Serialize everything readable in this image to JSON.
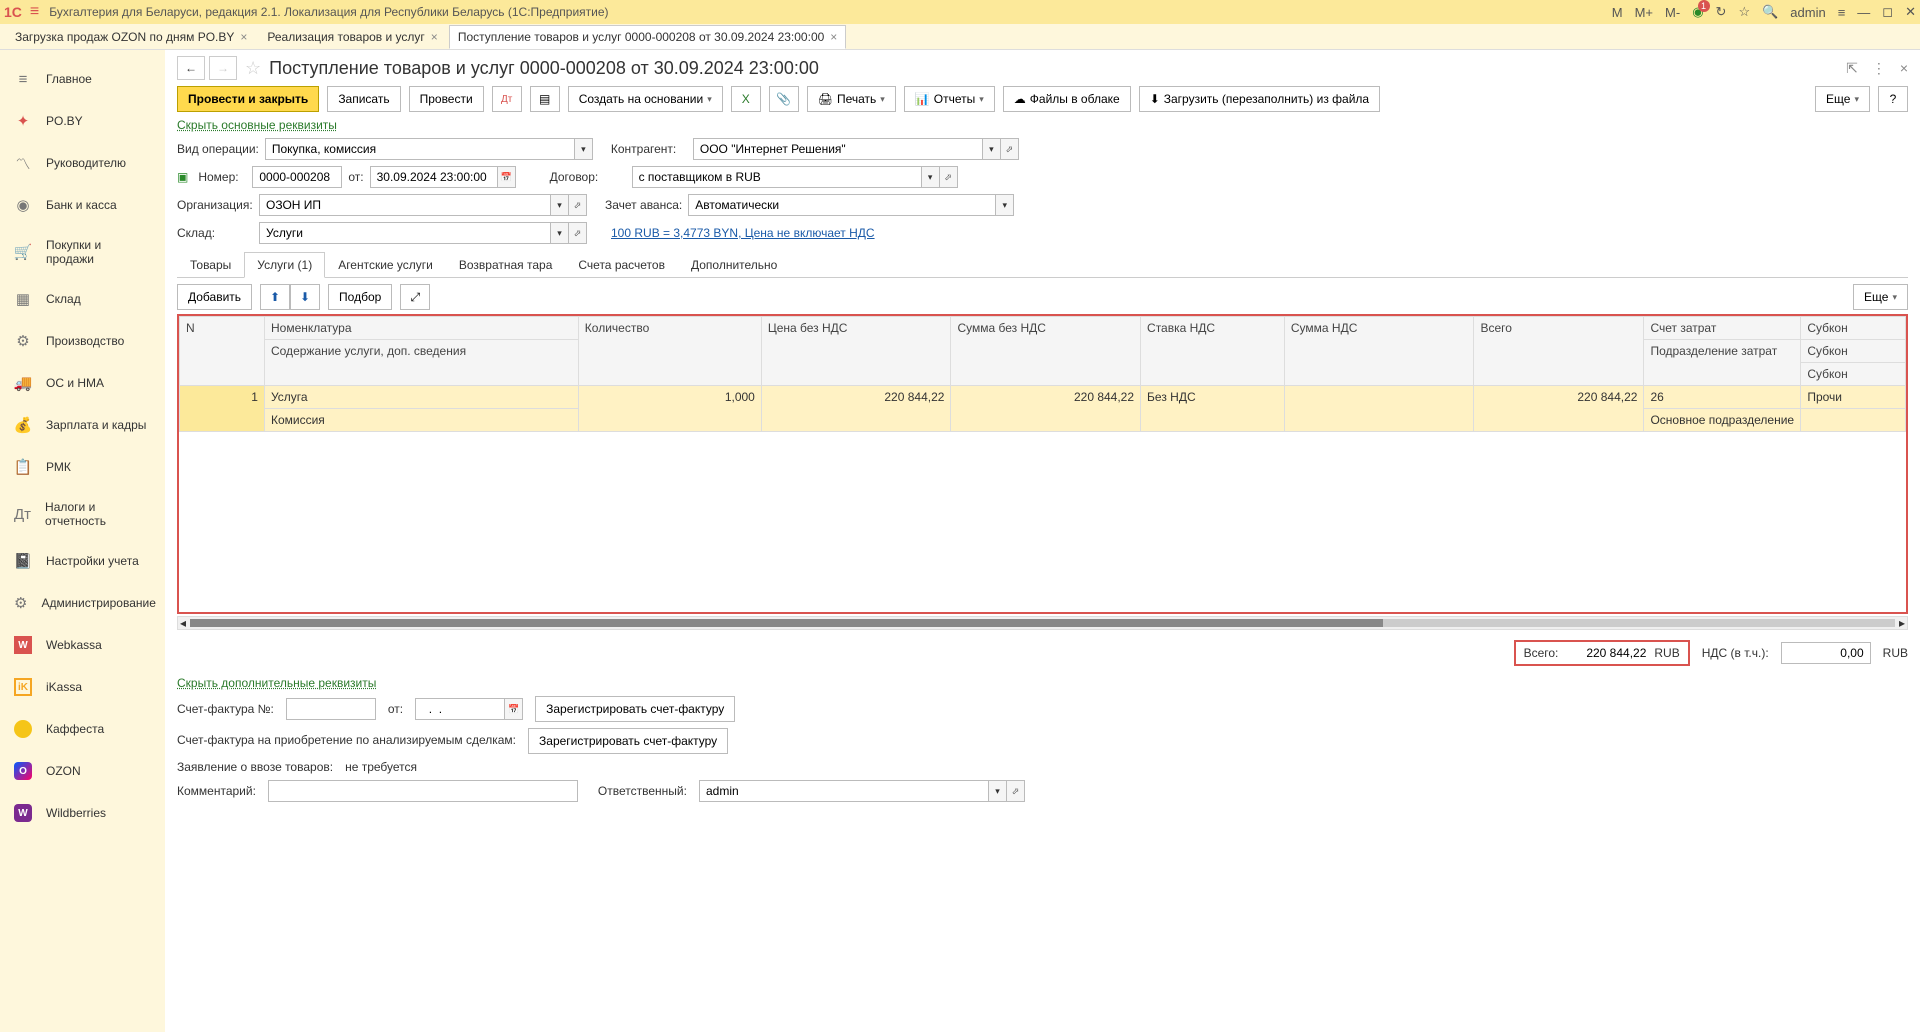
{
  "titlebar": {
    "app_title": "Бухгалтерия для Беларуси, редакция 2.1. Локализация для Республики Беларусь   (1С:Предприятие)",
    "m": "M",
    "m_plus": "M+",
    "m_minus": "M-",
    "badge": "1",
    "user": "admin"
  },
  "tabs": [
    {
      "label": "Загрузка продаж OZON по дням PO.BY",
      "active": false
    },
    {
      "label": "Реализация товаров и услуг",
      "active": false
    },
    {
      "label": "Поступление товаров и услуг 0000-000208 от 30.09.2024 23:00:00",
      "active": true
    }
  ],
  "sidebar": [
    {
      "label": "Главное",
      "icon": "home"
    },
    {
      "label": "PO.BY",
      "icon": "star-red"
    },
    {
      "label": "Руководителю",
      "icon": "chart"
    },
    {
      "label": "Банк и касса",
      "icon": "wallet"
    },
    {
      "label": "Покупки и продажи",
      "icon": "cart"
    },
    {
      "label": "Склад",
      "icon": "boxes"
    },
    {
      "label": "Производство",
      "icon": "factory"
    },
    {
      "label": "ОС и НМА",
      "icon": "truck"
    },
    {
      "label": "Зарплата и кадры",
      "icon": "money"
    },
    {
      "label": "РМК",
      "icon": "clipboard"
    },
    {
      "label": "Налоги и отчетность",
      "icon": "tax"
    },
    {
      "label": "Настройки учета",
      "icon": "gear"
    },
    {
      "label": "Администрирование",
      "icon": "cog"
    },
    {
      "label": "Webkassa",
      "icon": "wk"
    },
    {
      "label": "iKassa",
      "icon": "ik"
    },
    {
      "label": "Каффеста",
      "icon": "orange"
    },
    {
      "label": "OZON",
      "icon": "ozon"
    },
    {
      "label": "Wildberries",
      "icon": "wb"
    }
  ],
  "doc": {
    "title": "Поступление товаров и услуг 0000-000208 от 30.09.2024 23:00:00",
    "toolbar": {
      "post_close": "Провести и закрыть",
      "save": "Записать",
      "post": "Провести",
      "create_based": "Создать на основании",
      "print": "Печать",
      "reports": "Отчеты",
      "cloud_files": "Файлы в облаке",
      "load_from_file": "Загрузить (перезаполнить) из файла",
      "more": "Еще"
    },
    "links": {
      "hide_main": "Скрыть основные реквизиты",
      "rate_info": "100 RUB = 3,4773 BYN, Цена не включает НДС",
      "hide_extra": "Скрыть дополнительные реквизиты"
    },
    "form": {
      "operation_label": "Вид операции:",
      "operation": "Покупка, комиссия",
      "counterparty_label": "Контрагент:",
      "counterparty": "ООО \"Интернет Решения\"",
      "number_label": "Номер:",
      "number": "0000-000208",
      "date_label": "от:",
      "date": "30.09.2024 23:00:00",
      "contract_label": "Договор:",
      "contract": "с поставщиком в RUB",
      "org_label": "Организация:",
      "org": "ОЗОН ИП",
      "advance_label": "Зачет аванса:",
      "advance": "Автоматически",
      "warehouse_label": "Склад:",
      "warehouse": "Услуги"
    },
    "doc_tabs": [
      {
        "label": "Товары"
      },
      {
        "label": "Услуги (1)"
      },
      {
        "label": "Агентские услуги"
      },
      {
        "label": "Возвратная тара"
      },
      {
        "label": "Счета расчетов"
      },
      {
        "label": "Дополнительно"
      }
    ],
    "table_toolbar": {
      "add": "Добавить",
      "select": "Подбор",
      "more": "Еще"
    },
    "table": {
      "headers": {
        "n": "N",
        "nomenclature": "Номенклатура",
        "nom_sub": "Содержание услуги, доп. сведения",
        "quantity": "Количество",
        "price_no_vat": "Цена без НДС",
        "sum_no_vat": "Сумма без НДС",
        "vat_rate": "Ставка НДС",
        "vat_sum": "Сумма НДС",
        "total": "Всего",
        "cost_account": "Счет затрат",
        "cost_acc_sub": "Подразделение затрат",
        "subcon": "Субкон"
      },
      "rows": [
        {
          "n": "1",
          "nomenclature": "Услуга",
          "nom_sub": "Комиссия",
          "quantity": "1,000",
          "price_no_vat": "220 844,22",
          "sum_no_vat": "220 844,22",
          "vat_rate": "Без НДС",
          "vat_sum": "",
          "total": "220 844,22",
          "cost_account": "26",
          "cost_acc_sub": "Основное подразделение",
          "subcon": "Прочи"
        }
      ]
    },
    "totals": {
      "total_label": "Всего:",
      "total_value": "220 844,22",
      "total_cur": "RUB",
      "vat_label": "НДС (в т.ч.):",
      "vat_value": "0,00",
      "vat_cur": "RUB"
    },
    "footer": {
      "invoice_num_label": "Счет-фактура №:",
      "invoice_num": "",
      "invoice_date_label": "от:",
      "invoice_date": "  .  .    ",
      "register_invoice": "Зарегистрировать счет-фактуру",
      "invoice_acq_label": "Счет-фактура на приобретение по анализируемым сделкам:",
      "register_invoice2": "Зарегистрировать счет-фактуру",
      "import_decl_label": "Заявление о ввозе товаров:",
      "import_decl_value": "не требуется",
      "comment_label": "Комментарий:",
      "comment": "",
      "responsible_label": "Ответственный:",
      "responsible": "admin"
    }
  }
}
